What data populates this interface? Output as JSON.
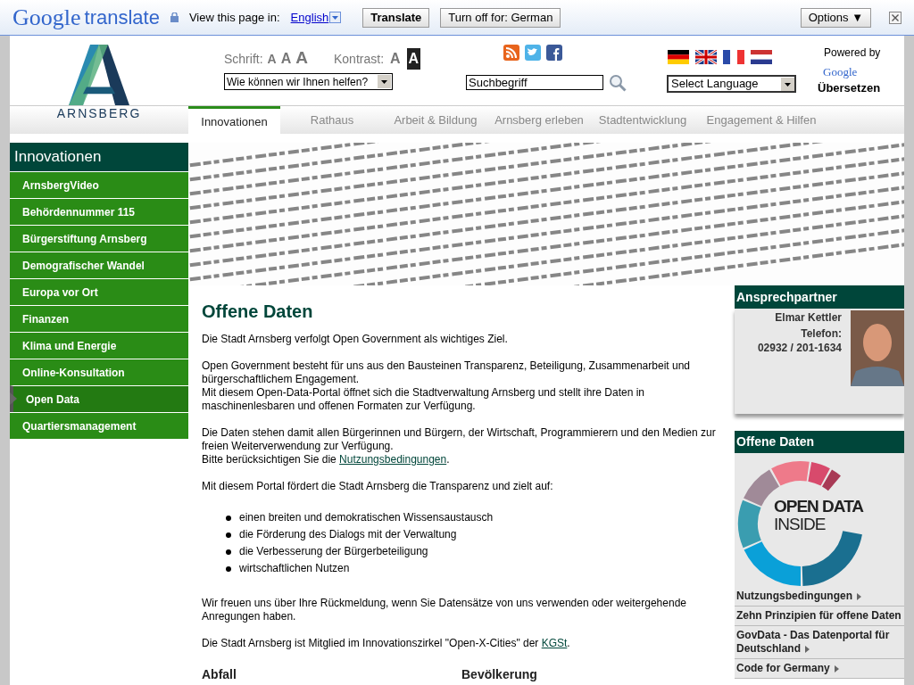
{
  "translate_bar": {
    "logo_google": "Google",
    "logo_translate": "translate",
    "prompt": "View this page in:",
    "language": "English",
    "translate_button": "Translate",
    "turn_off_button": "Turn off for: German",
    "options_button": "Options ▼"
  },
  "header": {
    "font_label": "Schrift:",
    "font_sizes": [
      "A",
      "A",
      "A"
    ],
    "contrast_label": "Kontrast:",
    "contrast_options": [
      {
        "label": "A",
        "selected": false
      },
      {
        "label": "A",
        "selected": true
      }
    ],
    "help_select": "Wie können wir Ihnen helfen?",
    "search_value": "Suchbegriff",
    "language_select": "Select Language",
    "powered_by": "Powered by",
    "google": "Google",
    "uebersetzen": "Übersetzen",
    "logo_text": "ARNSBERG"
  },
  "nav_tabs": [
    {
      "label": "Innovationen",
      "selected": true
    },
    {
      "label": "Rathaus",
      "selected": false
    },
    {
      "label": "Arbeit & Bildung",
      "selected": false
    },
    {
      "label": "Arnsberg erleben",
      "selected": false
    },
    {
      "label": "Stadtentwicklung",
      "selected": false
    },
    {
      "label": "Engagement & Hilfen",
      "selected": false
    }
  ],
  "sidebar": {
    "title": "Innovationen",
    "items": [
      {
        "label": "ArnsbergVideo",
        "selected": false
      },
      {
        "label": "Behördennummer 115",
        "selected": false
      },
      {
        "label": "Bürgerstiftung Arnsberg",
        "selected": false
      },
      {
        "label": "Demografischer Wandel",
        "selected": false
      },
      {
        "label": "Europa vor Ort",
        "selected": false
      },
      {
        "label": "Finanzen",
        "selected": false
      },
      {
        "label": "Klima und Energie",
        "selected": false
      },
      {
        "label": "Online-Konsultation",
        "selected": false
      },
      {
        "label": "Open Data",
        "selected": true
      },
      {
        "label": "Quartiersmanagement",
        "selected": false
      }
    ]
  },
  "content": {
    "title": "Offene Daten",
    "paragraphs": [
      {
        "lines": [
          "Die Stadt Arnsberg  verfolgt Open Government als wichtiges Ziel."
        ]
      },
      {
        "lines": [
          "Open Government besteht für uns aus den Bausteinen Transparenz, Beteiligung, Zusammenarbeit und bürgerschaftlichem Engagement.",
          "Mit diesem Open-Data-Portal öffnet sich die Stadtverwaltung Arnsberg und stellt ihre Daten in maschinenlesbaren und offenen Formaten zur Verfügung."
        ]
      },
      {
        "lines": [
          "Die Daten stehen damit allen Bürgerinnen und Bürgern, der Wirtschaft, Programmierern und den Medien zur freien Weiterverwendung zur Verfügung."
        ],
        "link_prefix": "Bitte berücksichtigen Sie die ",
        "link": "Nutzungsbedingungen",
        "link_suffix": "."
      },
      {
        "lines": [
          "Mit diesem Portal fördert die Stadt Arnsberg die Transparenz und zielt auf:"
        ]
      }
    ],
    "bullets": [
      "einen breiten und demokratischen Wissensaustausch",
      "die Förderung des Dialogs mit der Verwaltung",
      "die Verbesserung der Bürgerbeteiligung",
      "wirtschaftlichen Nutzen"
    ],
    "closing": [
      "Wir freuen uns über Ihre Rückmeldung, wenn Sie Datensätze von uns verwenden oder weitergehende Anregungen haben."
    ],
    "member_prefix": "Die Stadt Arnsberg ist Mitglied im Innovationszirkel \"Open-X-Cities\" der ",
    "member_link": "KGSt",
    "member_suffix": ".",
    "categories": [
      "Abfall",
      "Bevölkerung"
    ]
  },
  "contact": {
    "title": "Ansprechpartner",
    "name": "Elmar Kettler",
    "phone_label": "Telefon:",
    "phone": "02932 / 201-1634"
  },
  "open_data_box": {
    "title": "Offene Daten",
    "logo_line1": "OPEN DATA",
    "logo_line2": "INSIDE",
    "links": [
      {
        "label": "Nutzungsbedingungen",
        "arrow": true
      },
      {
        "label": "Zehn Prinzipien für offene Daten",
        "arrow": false
      },
      {
        "label": "GovData - Das Datenportal für Deutschland",
        "arrow": true
      },
      {
        "label": "Code for Germany",
        "arrow": true
      }
    ]
  }
}
